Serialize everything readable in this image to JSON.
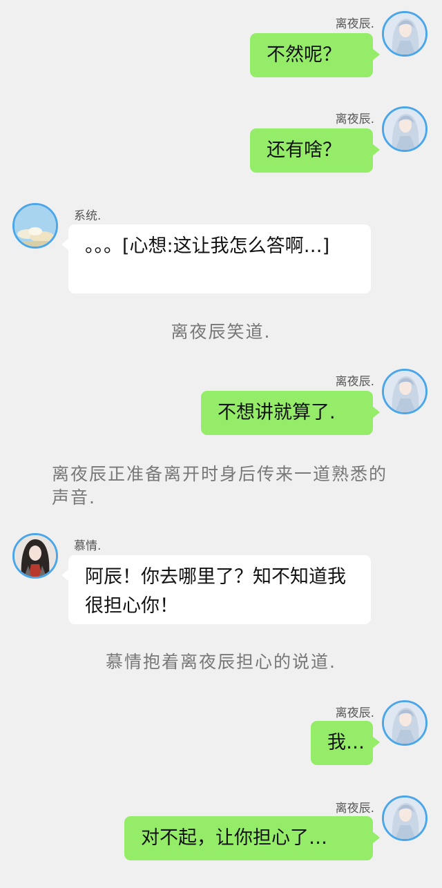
{
  "messages": [
    {
      "sender": "离夜辰.",
      "text": "不然呢？"
    },
    {
      "sender": "离夜辰.",
      "text": "还有啥？"
    },
    {
      "sender": "系统.",
      "text": "。。。[心想:这让我怎么答啊…]"
    },
    {
      "narration": "离夜辰笑道."
    },
    {
      "sender": "离夜辰.",
      "text": "不想讲就算了."
    },
    {
      "narration": "离夜辰正准备离开时身后传来一道熟悉的声音."
    },
    {
      "sender": "慕情.",
      "text": "阿辰！你去哪里了？知不知道我很担心你！"
    },
    {
      "narration": "慕情抱着离夜辰担心的说道."
    },
    {
      "sender": "离夜辰.",
      "text": "我…"
    },
    {
      "sender": "离夜辰.",
      "text": "对不起，让你担心了…"
    }
  ],
  "colors": {
    "background": "#f0f0f0",
    "self_bubble": "#95ec69",
    "other_bubble": "#ffffff",
    "avatar_border": "#4aa6e8"
  },
  "avatars": {
    "self": "pale-hair-character-avatar",
    "system": "sky-clouds-avatar",
    "muqing": "dark-hair-character-avatar"
  }
}
